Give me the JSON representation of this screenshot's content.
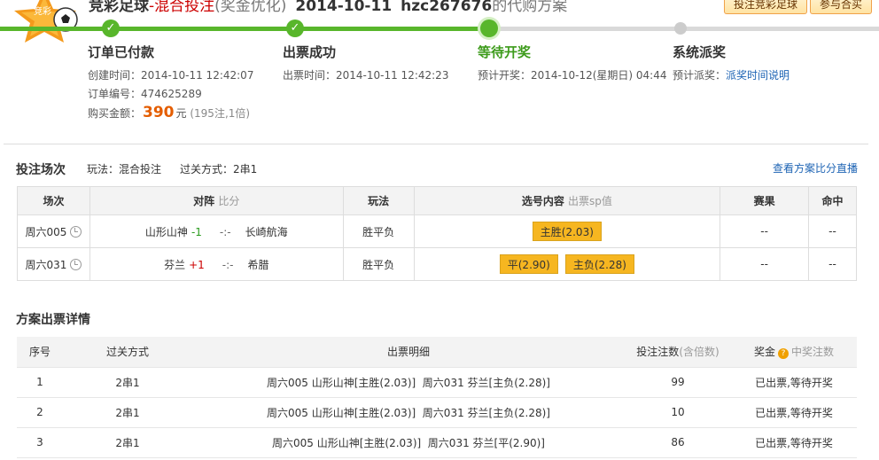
{
  "header": {
    "lottery": "竞彩足球",
    "sep": "-",
    "mode": "混合投注",
    "bonus": "(奖金优化)",
    "date": "2014-10-11",
    "user": "hzc267676",
    "suffix": "的代购方案",
    "buttons": [
      "投注竞彩足球",
      "参与合买"
    ],
    "logo_text": "竞彩"
  },
  "steps": [
    {
      "title": "订单已付款",
      "lines": [
        "创建时间：2014-10-11 12:42:07",
        "订单编号：474625289"
      ],
      "amount_label": "购买金额：",
      "amount": "390",
      "amount_unit": "元",
      "amount_note": "(195注,1倍)"
    },
    {
      "title": "出票成功",
      "lines": [
        "出票时间：2014-10-11 12:42:23"
      ]
    },
    {
      "title": "等待开奖",
      "lines": [
        "预计开奖：2014-10-12(星期日) 04:44"
      ]
    },
    {
      "title": "系统派奖",
      "prefix": "预计派奖：",
      "link": "派奖时间说明"
    }
  ],
  "bet_section": {
    "title": "投注场次",
    "play_label": "玩法：",
    "play": "混合投注",
    "pass_label": "过关方式：",
    "pass": "2串1",
    "live_link": "查看方案比分直播",
    "headers": [
      "场次",
      "对阵",
      "比分",
      "玩法",
      "选号内容",
      "出票sp值",
      "赛果",
      "命中"
    ],
    "rows": [
      {
        "match_no": "周六005",
        "home": "山形山神",
        "handicap": "-1",
        "score": "-:-",
        "away": "长崎航海",
        "play": "胜平负",
        "picks": [
          "主胜(2.03)"
        ],
        "result": "--",
        "hit": "--"
      },
      {
        "match_no": "周六031",
        "home": "芬兰",
        "handicap": "+1",
        "score": "-:-",
        "away": "希腊",
        "play": "胜平负",
        "picks": [
          "平(2.90)",
          "主负(2.28)"
        ],
        "result": "--",
        "hit": "--"
      }
    ]
  },
  "ticket_section": {
    "title": "方案出票详情",
    "headers": [
      "序号",
      "过关方式",
      "出票明细",
      "投注注数",
      "(含倍数)",
      "奖金",
      "中奖注数"
    ],
    "rows": [
      {
        "no": "1",
        "pass": "2串1",
        "detail": "周六005 山形山神[主胜(2.03)]  周六031 芬兰[主负(2.28)]",
        "count": "99",
        "status": "已出票,等待开奖"
      },
      {
        "no": "2",
        "pass": "2串1",
        "detail": "周六005 山形山神[主胜(2.03)]  周六031 芬兰[主负(2.28)]",
        "count": "10",
        "status": "已出票,等待开奖"
      },
      {
        "no": "3",
        "pass": "2串1",
        "detail": "周六005 山形山神[主胜(2.03)]  周六031 芬兰[平(2.90)]",
        "count": "86",
        "status": "已出票,等待开奖"
      }
    ]
  },
  "colors": {
    "progress": "#58b62b",
    "accent": "#e45d00",
    "link": "#1e64b4",
    "pick": "#f6b620"
  }
}
